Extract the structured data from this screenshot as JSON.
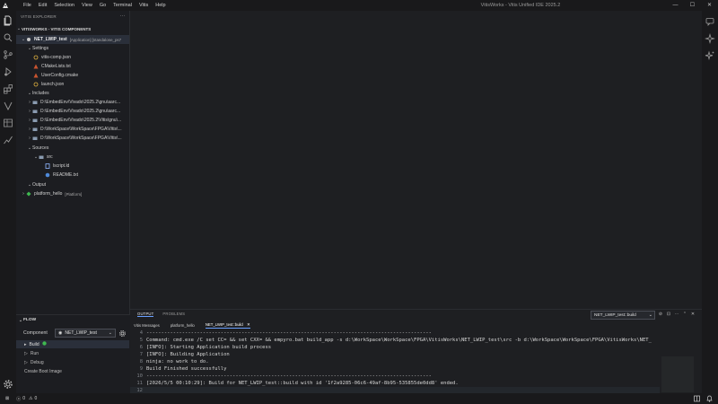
{
  "menu": [
    "File",
    "Edit",
    "Selection",
    "View",
    "Go",
    "Terminal",
    "Vitis",
    "Help"
  ],
  "app_title": "VitisWorks - Vitis Unified IDE 2025.2",
  "window_controls": {
    "minimize": "—",
    "maximize": "☐",
    "close": "✕"
  },
  "explorer": {
    "title": "VITIS EXPLORER",
    "more": "···",
    "section": "VITISWORKS - VITIS COMPONENTS",
    "component": {
      "name": "NET_LWIP_test",
      "type": "[Application] [standalone_ps7"
    },
    "settings_label": "Settings",
    "settings_files": [
      "vitis-comp.json",
      "CMakeLists.txt",
      "UserConfig.cmake",
      "launch.json"
    ],
    "includes_label": "Includes",
    "includes": [
      "D:\\EmbedEnv\\Vivado\\2025.2\\gnu\\aarc...",
      "D:\\EmbedEnv\\Vivado\\2025.2\\gnu\\aarc...",
      "D:\\EmbedEnv\\Vivado\\2025.2\\Vitis\\gnu\\...",
      "D:\\WorkSpace\\WorkSpace\\FPGA\\Vitis\\...",
      "D:\\WorkSpace\\WorkSpace\\FPGA\\Vitis\\..."
    ],
    "sources_label": "Sources",
    "src_label": "src",
    "src_files": [
      "lscript.ld",
      "README.txt"
    ],
    "output_label": "Output",
    "platform": {
      "name": "platform_hello",
      "type": "[Platform]"
    }
  },
  "flow": {
    "title": "FLOW",
    "component_label": "Component",
    "component_value": "NET_LWIP_test",
    "items": [
      "Build",
      "Run",
      "Debug",
      "Create Boot Image"
    ]
  },
  "panel": {
    "tabs": [
      "OUTPUT",
      "PROBLEMS"
    ],
    "subtabs": [
      "Vitis Messages",
      "platform_hello",
      "NET_LWIP_test::build"
    ],
    "output_channel": "NET_LWIP_test::build",
    "lines": [
      {
        "n": "4",
        "t": "------------------------------------------------------------------------------------------------"
      },
      {
        "n": "5",
        "t": "Command: cmd.exe /C set CC= && set CXX= && empyro.bat build_app -s d:\\WorkSpace\\WorkSpace\\FPGA\\VitisWorks\\NET_LWIP_test\\src -b d:\\WorkSpace\\WorkSpace\\FPGA\\VitisWorks\\NET_"
      },
      {
        "n": "6",
        "t": "[INFO]: Starting Application build process"
      },
      {
        "n": "7",
        "t": "[INFO]: Building Application"
      },
      {
        "n": "8",
        "t": "ninja: no work to do."
      },
      {
        "n": "9",
        "t": "Build Finished successfully"
      },
      {
        "n": "10",
        "t": "------------------------------------------------------------------------------------------------"
      },
      {
        "n": "11",
        "t": "[2026/5/5 00:10:29]: Build for NET_LWIP_test::build with id '1f2a9285-06c6-49af-8b95-535855de0dd8' ended."
      },
      {
        "n": "12",
        "t": ""
      }
    ]
  },
  "status": {
    "errors": "0",
    "warnings": "0",
    "bell": ""
  },
  "colors": {
    "accent": "#6aa0ff",
    "build_ok": "#3fb950",
    "folder": "#8a9bb0",
    "json": "#e2b340",
    "cmake": "#c9542f"
  }
}
